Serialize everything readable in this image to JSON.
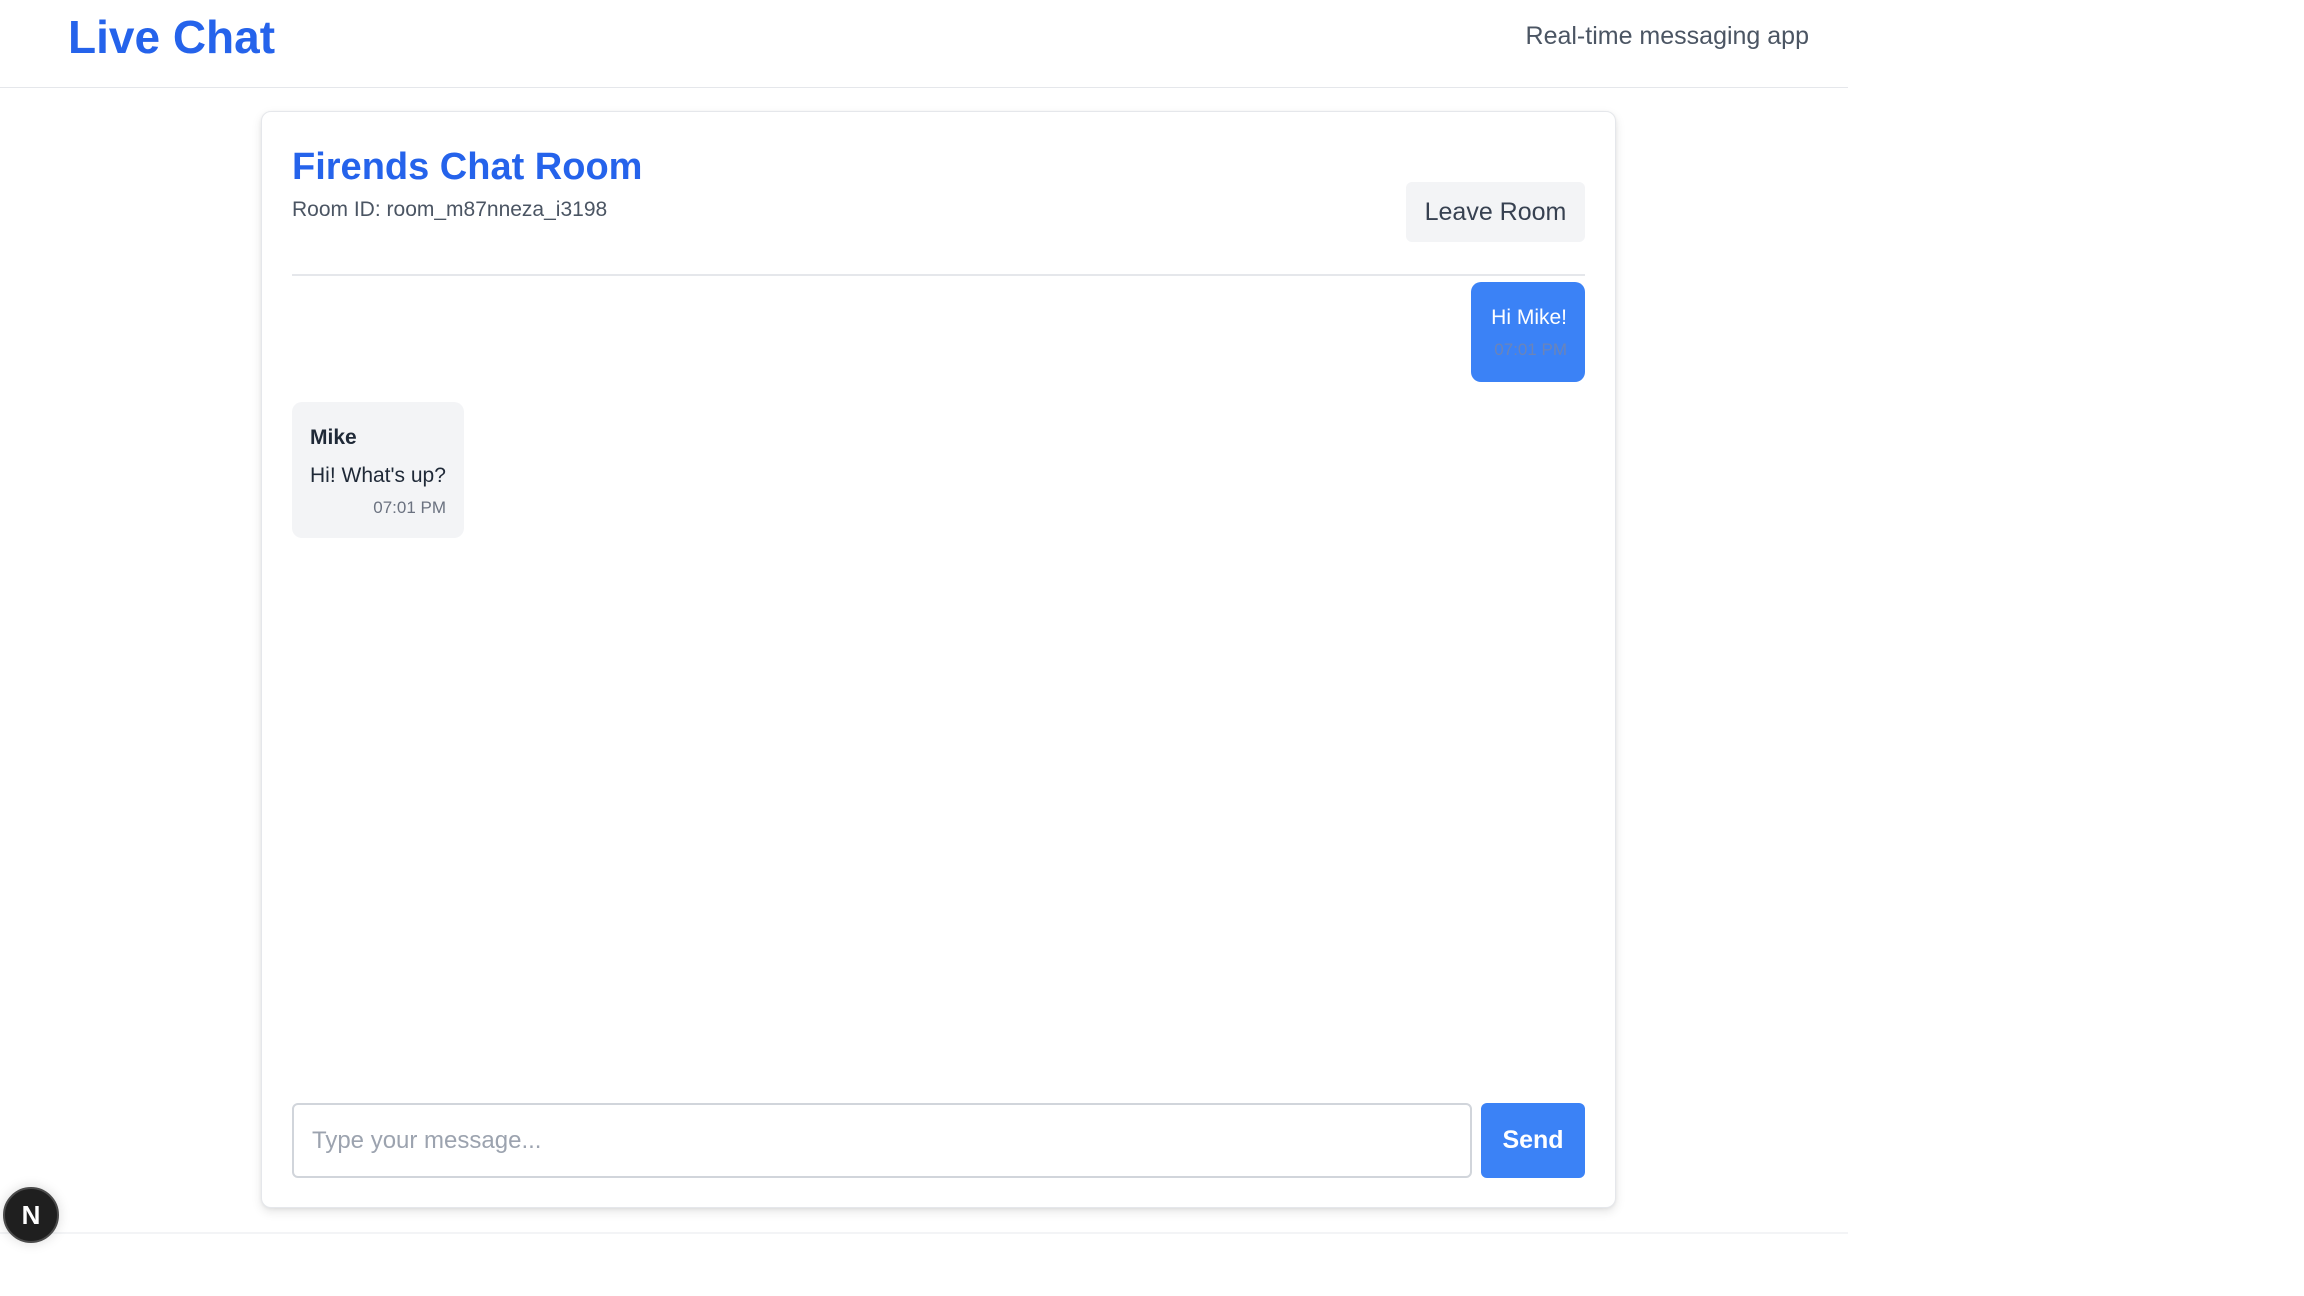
{
  "header": {
    "brand": "Live Chat",
    "tagline": "Real-time messaging app"
  },
  "room": {
    "title": "Firends Chat Room",
    "id_text": "Room ID: room_m87nneza_i3198",
    "leave_label": "Leave Room"
  },
  "messages": [
    {
      "sender": "",
      "text": "Hi Mike!",
      "time": "07:01 PM",
      "mine": true
    },
    {
      "sender": "Mike",
      "text": "Hi! What's up?",
      "time": "07:01 PM",
      "mine": false
    }
  ],
  "composer": {
    "placeholder": "Type your message...",
    "value": "",
    "send_label": "Send"
  },
  "dev_badge": {
    "letter": "N",
    "icon": "nextjs-icon"
  },
  "colors": {
    "accent": "#2563eb",
    "button_primary": "#3b82f6",
    "bubble_other": "#f3f4f6"
  }
}
